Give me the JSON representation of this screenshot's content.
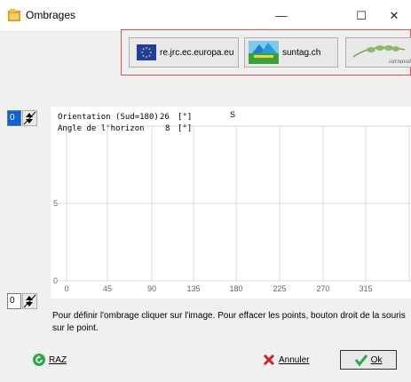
{
  "window": {
    "title": "Ombrages",
    "minimize": "—",
    "maximize": "☐",
    "close": "✕"
  },
  "links": [
    {
      "label": "re.jrc.ec.europa.eu",
      "icon": "eu-flag-icon"
    },
    {
      "label": "suntag.ch",
      "icon": "suntag-logo-icon"
    },
    {
      "label": "carnaval",
      "icon": "carnaval-logo-icon"
    }
  ],
  "steppers": {
    "top_value": "0",
    "bottom_value": "0"
  },
  "plot": {
    "orientation_label": "Orientation (Sud=180)",
    "orientation_value": "26",
    "orientation_unit": "[°]",
    "horizon_label": "Angle de l'horizon",
    "horizon_value": "8",
    "horizon_unit": "[°]",
    "south_marker": "S",
    "y_ticks": [
      "5",
      "0"
    ],
    "x_ticks": [
      "0",
      "45",
      "90",
      "135",
      "180",
      "225",
      "270",
      "315"
    ]
  },
  "info_text": "Pour définir l'ombrage cliquer sur l'image. Pour effacer les points, bouton droit de la souris sur le point.",
  "footer": {
    "raz": "RAZ",
    "annuler": "Annuler",
    "ok": "Ok"
  },
  "colors": {
    "grid": "#d9d9d9",
    "accent_blue": "#0a64d6",
    "border_red": "#e05050"
  }
}
